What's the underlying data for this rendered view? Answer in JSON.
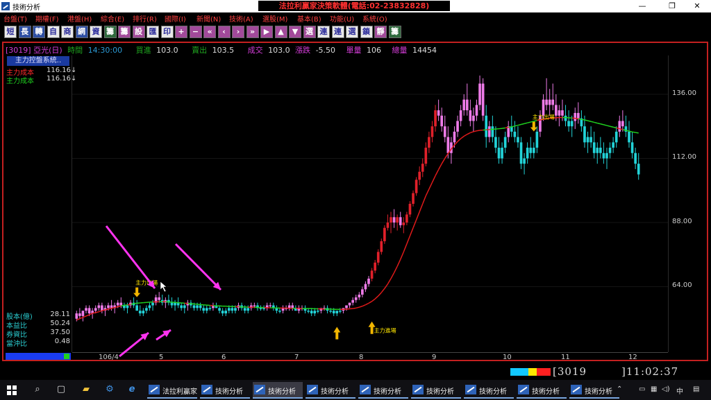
{
  "window": {
    "title": "技術分析",
    "banner": "法拉利贏家決策軟體(電話:02-23832828)",
    "controls": {
      "minimize": "—",
      "restore": "❐",
      "close": "✕"
    }
  },
  "menu": [
    "台盤(T)",
    "期權(F)",
    "港盤(H)",
    "綜合(E)",
    "排行(R)",
    "國際(I)",
    "新聞(N)",
    "技術(A)",
    "選股(M)",
    "基本(B)",
    "功能(U)",
    "系統(O)"
  ],
  "toolbar": {
    "buttons": [
      {
        "label": "短",
        "style": "w"
      },
      {
        "label": "長",
        "style": "b"
      },
      {
        "label": "轉",
        "style": "b"
      },
      {
        "label": "自",
        "style": "w"
      },
      {
        "label": "商",
        "style": "w"
      },
      {
        "label": "網",
        "style": "b"
      },
      {
        "label": "資",
        "style": "w"
      },
      {
        "label": "籌",
        "style": "g"
      },
      {
        "label": "籌",
        "style": "m"
      },
      {
        "label": "設",
        "style": "m"
      },
      {
        "label": "匯",
        "style": "w"
      },
      {
        "label": "印",
        "style": "w"
      },
      {
        "label": "+",
        "style": "m"
      },
      {
        "label": "−",
        "style": "m"
      },
      {
        "label": "«",
        "style": "m"
      },
      {
        "label": "‹",
        "style": "m"
      },
      {
        "label": "›",
        "style": "m"
      },
      {
        "label": "»",
        "style": "m"
      },
      {
        "label": "▶",
        "style": "m"
      },
      {
        "label": "▲",
        "style": "m"
      },
      {
        "label": "▼",
        "style": "m"
      },
      {
        "label": "選",
        "style": "m"
      },
      {
        "label": "連",
        "style": "w"
      },
      {
        "label": "連",
        "style": "w"
      },
      {
        "label": "選",
        "style": "w"
      },
      {
        "label": "鎖",
        "style": "w"
      },
      {
        "label": "靜",
        "style": "m"
      },
      {
        "label": "籌",
        "style": "g"
      }
    ]
  },
  "quote": {
    "code_label": "[3019] 亞光(日)",
    "time_label": "時間",
    "time": "14:30:00",
    "bid_label": "買進",
    "bid": "103.0",
    "ask_label": "賣出",
    "ask": "103.5",
    "deal_label": "成交",
    "deal": "103.0",
    "change_label": "漲跌",
    "change": "-5.50",
    "volume_label": "單量",
    "volume": "106",
    "total_label": "總量",
    "total": "14454"
  },
  "panel": {
    "title": "主力控盤系統..",
    "legend": [
      {
        "label": "主力成本",
        "value": "116.16↓",
        "color": "#ff2a2a"
      },
      {
        "label": "主力成本",
        "value": "116.16↓",
        "color": "#1fd11f"
      }
    ],
    "stats": [
      {
        "label": "股本(億)",
        "value": "28.11"
      },
      {
        "label": "本益比",
        "value": "50.24"
      },
      {
        "label": "券資比",
        "value": "37.50"
      },
      {
        "label": "當沖比",
        "value": "0.48"
      }
    ]
  },
  "chart_data": {
    "type": "candlestick",
    "ylim": [
      40,
      150
    ],
    "yticks": [
      "136.00",
      "112.00",
      "88.00",
      "64.00"
    ],
    "ytick_values": [
      136,
      112,
      88,
      64
    ],
    "xticks": [
      "106/4",
      "5",
      "6",
      "7",
      "8",
      "9",
      "10",
      "11",
      "12"
    ],
    "annotations": [
      {
        "text": "主力出場",
        "date_index": 19,
        "price": 58,
        "arrow": "down"
      },
      {
        "text": "主力出場",
        "date_index": 144,
        "price": 120,
        "arrow": "down"
      },
      {
        "text": "主力進場",
        "date_index": 93,
        "price": 52,
        "arrow": "up"
      },
      {
        "text": "",
        "date_index": 82,
        "price": 50,
        "arrow": "up"
      }
    ],
    "series": [
      {
        "key": "main_cost_red",
        "color": "#e01a1a"
      },
      {
        "key": "main_cost_green",
        "color": "#1fd11f"
      }
    ],
    "ma_values": [
      51.5,
      52,
      52.5,
      53,
      53.5,
      54,
      54.3,
      54.6,
      55,
      55.3,
      55.6,
      55.9,
      56.2,
      56.5,
      56.8,
      57,
      57.2,
      57.4,
      57.6,
      57.8,
      57.9,
      58,
      58.1,
      58.2,
      58.3,
      58.3,
      58.4,
      58.4,
      58.4,
      58.3,
      58.2,
      58.1,
      58,
      57.9,
      57.8,
      57.7,
      57.6,
      57.5,
      57.4,
      57.3,
      57.2,
      57.1,
      57,
      56.9,
      56.8,
      56.8,
      56.7,
      56.7,
      56.6,
      56.6,
      56.5,
      56.5,
      56.4,
      56.4,
      56.3,
      56.3,
      56.3,
      56.2,
      56.2,
      56.2,
      56.1,
      56.1,
      56.1,
      56,
      56,
      56,
      56,
      55.9,
      55.9,
      55.9,
      55.9,
      55.8,
      55.8,
      55.8,
      55.8,
      55.7,
      55.7,
      55.7,
      55.6,
      55.6,
      55.6,
      55.5,
      55.5,
      55.5,
      55.5,
      55.6,
      55.7,
      55.8,
      56,
      56.3,
      56.7,
      57.2,
      57.8,
      58.5,
      59.4,
      60.5,
      61.8,
      63.3,
      65,
      67,
      69.2,
      71.6,
      74.2,
      77,
      80,
      83,
      86,
      89,
      92,
      95,
      98,
      100.5,
      103,
      105.5,
      107.8,
      110,
      112,
      113.8,
      115.5,
      117,
      118.3,
      119.4,
      120.3,
      121,
      121.6,
      122,
      122.3,
      122.5,
      122.6,
      122.7,
      122.8,
      122.9,
      123,
      123.1,
      123.2,
      123.4,
      123.6,
      123.8,
      124.1,
      124.4,
      124.7,
      125,
      125.3,
      125.6,
      125.9,
      126.2,
      126.4,
      126.6,
      126.8,
      127,
      127.1,
      127.2,
      127.3,
      127.3,
      127.3,
      127.2,
      127.1,
      127,
      126.8,
      126.6,
      126.4,
      126.1,
      125.8,
      125.5,
      125.2,
      124.9,
      124.6,
      124.3,
      124,
      123.7,
      123.4,
      123.1,
      122.8,
      122.5,
      122.2,
      121.9,
      121.7,
      121.5,
      121.3,
      121.1,
      120.9,
      120.7,
      120.5,
      120.3,
      120.1,
      119.8,
      119.4,
      118.9,
      118.3,
      117.6,
      117,
      116.4,
      115.8,
      115.2
    ],
    "ohlc": [
      [
        52,
        55,
        51,
        54
      ],
      [
        54,
        56,
        52,
        53
      ],
      [
        53,
        55,
        51,
        55
      ],
      [
        55,
        57,
        54,
        56
      ],
      [
        56,
        57,
        53,
        54
      ],
      [
        54,
        56,
        52,
        55
      ],
      [
        55,
        57,
        54,
        56
      ],
      [
        56,
        58,
        55,
        57
      ],
      [
        57,
        58,
        54,
        55
      ],
      [
        55,
        57,
        53,
        56
      ],
      [
        56,
        58,
        55,
        57
      ],
      [
        57,
        59,
        55,
        56
      ],
      [
        56,
        58,
        54,
        57
      ],
      [
        57,
        59,
        56,
        58
      ],
      [
        58,
        60,
        56,
        57
      ],
      [
        57,
        58,
        55,
        56
      ],
      [
        56,
        58,
        54,
        57
      ],
      [
        57,
        59,
        56,
        58
      ],
      [
        58,
        60,
        56,
        57
      ],
      [
        57,
        59,
        55,
        55
      ],
      [
        55,
        57,
        53,
        54
      ],
      [
        54,
        56,
        53,
        55
      ],
      [
        55,
        57,
        54,
        56
      ],
      [
        56,
        58,
        55,
        57
      ],
      [
        57,
        59,
        55,
        58
      ],
      [
        58,
        61,
        57,
        60
      ],
      [
        60,
        62,
        58,
        59
      ],
      [
        59,
        61,
        57,
        58
      ],
      [
        58,
        60,
        56,
        59
      ],
      [
        59,
        61,
        57,
        58
      ],
      [
        58,
        60,
        56,
        57
      ],
      [
        57,
        59,
        55,
        58
      ],
      [
        58,
        60,
        56,
        57
      ],
      [
        57,
        58,
        55,
        56
      ],
      [
        56,
        58,
        54,
        57
      ],
      [
        57,
        59,
        55,
        58
      ],
      [
        58,
        59,
        56,
        57
      ],
      [
        57,
        58,
        55,
        56
      ],
      [
        56,
        58,
        55,
        57
      ],
      [
        57,
        58,
        55,
        56
      ],
      [
        56,
        57,
        54,
        55
      ],
      [
        55,
        57,
        54,
        56
      ],
      [
        56,
        57,
        55,
        56
      ],
      [
        56,
        58,
        55,
        57
      ],
      [
        57,
        58,
        56,
        56
      ],
      [
        56,
        57,
        54,
        55
      ],
      [
        55,
        56,
        53,
        54
      ],
      [
        54,
        56,
        53,
        55
      ],
      [
        55,
        57,
        54,
        56
      ],
      [
        56,
        57,
        54,
        55
      ],
      [
        55,
        57,
        54,
        56
      ],
      [
        56,
        58,
        55,
        57
      ],
      [
        57,
        58,
        55,
        56
      ],
      [
        56,
        57,
        54,
        55
      ],
      [
        55,
        57,
        54,
        56
      ],
      [
        56,
        58,
        55,
        57
      ],
      [
        57,
        58,
        56,
        57
      ],
      [
        57,
        58,
        55,
        56
      ],
      [
        56,
        57,
        55,
        56
      ],
      [
        56,
        57,
        55,
        56
      ],
      [
        56,
        58,
        55,
        57
      ],
      [
        57,
        58,
        56,
        57
      ],
      [
        57,
        58,
        55,
        56
      ],
      [
        56,
        57,
        54,
        55
      ],
      [
        55,
        56,
        54,
        55
      ],
      [
        55,
        57,
        54,
        56
      ],
      [
        56,
        57,
        55,
        56
      ],
      [
        56,
        58,
        55,
        57
      ],
      [
        57,
        58,
        55,
        56
      ],
      [
        56,
        57,
        55,
        55
      ],
      [
        55,
        57,
        54,
        56
      ],
      [
        56,
        57,
        55,
        56
      ],
      [
        56,
        57,
        54,
        55
      ],
      [
        55,
        56,
        54,
        55
      ],
      [
        55,
        56,
        53,
        54
      ],
      [
        54,
        56,
        53,
        55
      ],
      [
        55,
        56,
        54,
        55
      ],
      [
        55,
        56,
        54,
        56
      ],
      [
        56,
        57,
        55,
        56
      ],
      [
        56,
        57,
        54,
        55
      ],
      [
        55,
        56,
        54,
        55
      ],
      [
        55,
        56,
        53,
        54
      ],
      [
        54,
        55,
        53,
        55
      ],
      [
        55,
        56,
        54,
        55
      ],
      [
        55,
        56,
        54,
        56
      ],
      [
        56,
        57,
        55,
        57
      ],
      [
        57,
        58,
        56,
        58
      ],
      [
        58,
        60,
        57,
        59
      ],
      [
        59,
        61,
        58,
        60
      ],
      [
        60,
        62,
        59,
        61
      ],
      [
        61,
        64,
        60,
        63
      ],
      [
        63,
        66,
        62,
        65
      ],
      [
        65,
        68,
        64,
        67
      ],
      [
        67,
        71,
        66,
        70
      ],
      [
        70,
        74,
        69,
        73
      ],
      [
        73,
        78,
        72,
        77
      ],
      [
        77,
        82,
        76,
        81
      ],
      [
        81,
        87,
        80,
        86
      ],
      [
        86,
        91,
        85,
        88
      ],
      [
        88,
        92,
        84,
        90
      ],
      [
        90,
        93,
        86,
        88
      ],
      [
        88,
        91,
        85,
        90
      ],
      [
        90,
        92,
        86,
        87
      ],
      [
        87,
        90,
        84,
        88
      ],
      [
        88,
        92,
        87,
        91
      ],
      [
        91,
        96,
        90,
        95
      ],
      [
        95,
        100,
        94,
        99
      ],
      [
        99,
        105,
        98,
        104
      ],
      [
        104,
        109,
        102,
        107
      ],
      [
        107,
        112,
        105,
        110
      ],
      [
        110,
        118,
        109,
        116
      ],
      [
        116,
        122,
        114,
        120
      ],
      [
        120,
        126,
        118,
        124
      ],
      [
        124,
        132,
        122,
        130
      ],
      [
        130,
        134,
        126,
        128
      ],
      [
        128,
        131,
        122,
        124
      ],
      [
        124,
        128,
        118,
        120
      ],
      [
        120,
        124,
        112,
        114
      ],
      [
        114,
        120,
        110,
        118
      ],
      [
        118,
        124,
        116,
        122
      ],
      [
        122,
        128,
        120,
        126
      ],
      [
        126,
        132,
        124,
        130
      ],
      [
        130,
        136,
        128,
        134
      ],
      [
        134,
        140,
        128,
        130
      ],
      [
        130,
        134,
        124,
        126
      ],
      [
        126,
        131,
        122,
        128
      ],
      [
        128,
        134,
        126,
        132
      ],
      [
        132,
        143,
        130,
        140
      ],
      [
        140,
        142,
        126,
        128
      ],
      [
        128,
        132,
        116,
        120
      ],
      [
        120,
        126,
        118,
        124
      ],
      [
        124,
        128,
        118,
        120
      ],
      [
        120,
        124,
        114,
        116
      ],
      [
        116,
        120,
        110,
        112
      ],
      [
        112,
        118,
        110,
        116
      ],
      [
        116,
        122,
        114,
        120
      ],
      [
        120,
        126,
        118,
        124
      ],
      [
        124,
        128,
        120,
        122
      ],
      [
        122,
        126,
        118,
        120
      ],
      [
        120,
        124,
        116,
        118
      ],
      [
        118,
        120,
        108,
        110
      ],
      [
        110,
        114,
        106,
        112
      ],
      [
        112,
        118,
        110,
        116
      ],
      [
        116,
        120,
        112,
        114
      ],
      [
        114,
        118,
        112,
        116
      ],
      [
        116,
        124,
        114,
        122
      ],
      [
        122,
        130,
        120,
        128
      ],
      [
        128,
        136,
        126,
        134
      ],
      [
        134,
        142,
        130,
        132
      ],
      [
        132,
        138,
        128,
        134
      ],
      [
        134,
        140,
        130,
        132
      ],
      [
        132,
        136,
        126,
        128
      ],
      [
        128,
        132,
        124,
        130
      ],
      [
        130,
        134,
        126,
        128
      ],
      [
        128,
        132,
        124,
        126
      ],
      [
        126,
        130,
        122,
        124
      ],
      [
        124,
        128,
        120,
        126
      ],
      [
        126,
        131,
        123,
        129
      ],
      [
        129,
        133,
        125,
        127
      ],
      [
        127,
        130,
        122,
        124
      ],
      [
        124,
        128,
        116,
        118
      ],
      [
        118,
        122,
        114,
        120
      ],
      [
        120,
        124,
        116,
        118
      ],
      [
        118,
        122,
        112,
        114
      ],
      [
        114,
        118,
        110,
        116
      ],
      [
        116,
        120,
        112,
        114
      ],
      [
        114,
        118,
        110,
        112
      ],
      [
        112,
        116,
        108,
        114
      ],
      [
        114,
        118,
        112,
        116
      ],
      [
        116,
        120,
        114,
        118
      ],
      [
        118,
        124,
        116,
        122
      ],
      [
        122,
        128,
        120,
        126
      ],
      [
        126,
        130,
        122,
        124
      ],
      [
        124,
        128,
        120,
        122
      ],
      [
        122,
        126,
        116,
        118
      ],
      [
        118,
        122,
        112,
        114
      ],
      [
        114,
        116,
        108,
        110
      ],
      [
        110,
        114,
        104,
        106
      ]
    ]
  },
  "status": {
    "code": "[3019",
    "clock": "]11:02:37",
    "swatches": [
      "#12c8ff",
      "#ffe600",
      "#ff2020"
    ]
  },
  "taskbar": {
    "search_icon": "⌕",
    "taskview_icon": "▢",
    "apps": [
      {
        "label": "法拉利贏家",
        "active": false
      },
      {
        "label": "技術分析",
        "active": false
      },
      {
        "label": "技術分析",
        "active": true
      },
      {
        "label": "技術分析",
        "active": false
      },
      {
        "label": "技術分析",
        "active": false
      },
      {
        "label": "技術分析",
        "active": false
      },
      {
        "label": "技術分析",
        "active": false
      },
      {
        "label": "技術分析",
        "active": false
      },
      {
        "label": "技術分析",
        "active": false
      }
    ],
    "ime": "中"
  }
}
